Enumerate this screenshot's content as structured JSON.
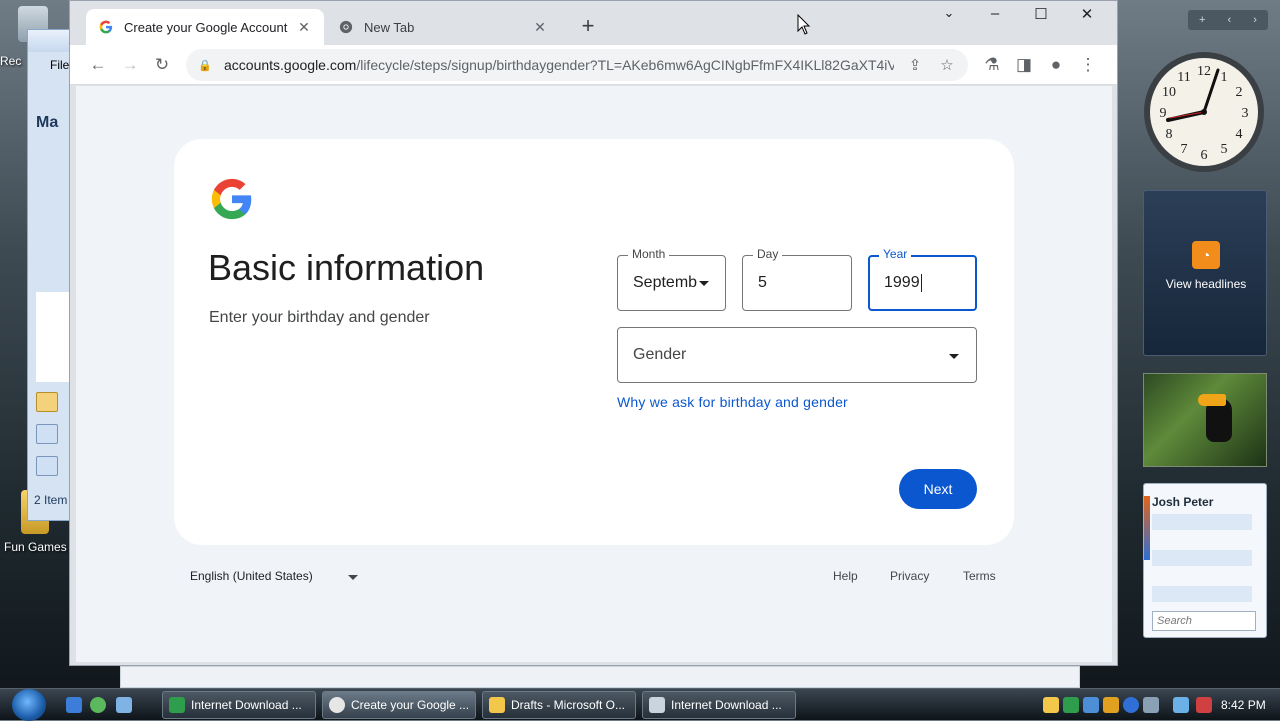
{
  "desktop": {
    "recycle_label": "Rec",
    "games_label": "Fun Games"
  },
  "outlook_bg": {
    "menu_label": "File",
    "pane_label": "Ma",
    "items_count": "2 Item"
  },
  "browser": {
    "tabs": [
      {
        "title": "Create your Google Account",
        "favicon": "G"
      },
      {
        "title": "New Tab",
        "favicon": "chrome"
      }
    ],
    "url_domain": "accounts.google.com",
    "url_path": "/lifecycle/steps/signup/birthdaygender?TL=AKeb6mw6AgCINgbFfmFX4IKLl82GaXT4iVi47..."
  },
  "page": {
    "title": "Basic information",
    "subtitle": "Enter your birthday and gender",
    "month": {
      "label": "Month",
      "value": "Septemb"
    },
    "day": {
      "label": "Day",
      "value": "5"
    },
    "year": {
      "label": "Year",
      "value": "1999"
    },
    "gender": {
      "label": "Gender"
    },
    "why_link": "Why we ask for birthday and gender",
    "next_button": "Next"
  },
  "footer": {
    "language": "English (United States)",
    "links": [
      "Help",
      "Privacy",
      "Terms"
    ]
  },
  "gadgets": {
    "rss_label": "View headlines",
    "contacts_name": "Josh Peter",
    "contacts_search_placeholder": "Search"
  },
  "taskbar": {
    "tasks": [
      "Internet Download ...",
      "Create your Google ...",
      "Drafts - Microsoft O...",
      "Internet Download ..."
    ],
    "time": "8:42 PM"
  },
  "colors": {
    "google_blue": "#0b57d0",
    "page_bg": "#f0f4f9"
  }
}
